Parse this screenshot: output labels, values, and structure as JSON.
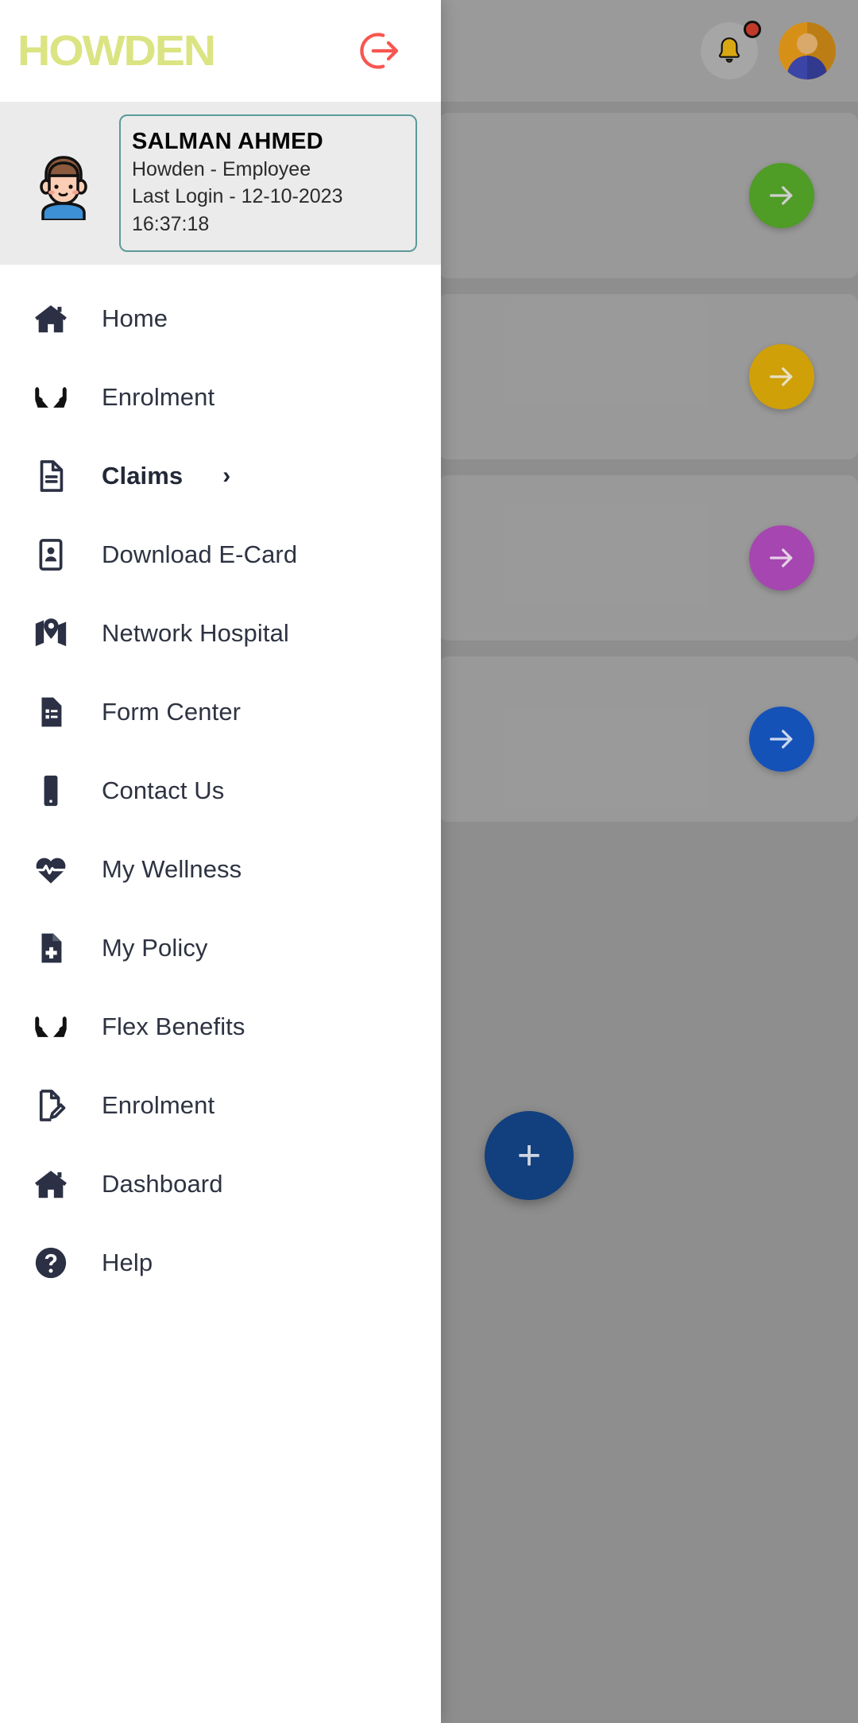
{
  "background": {
    "notification_bell": "bell-icon",
    "notification_badge": "",
    "profile_avatar": "avatar",
    "cards": [
      {
        "arrow": "arrow-right-icon",
        "color": "#4f9c26"
      },
      {
        "arrow": "arrow-right-icon",
        "color": "#cfa008"
      },
      {
        "arrow": "arrow-right-icon",
        "color": "#a646b0"
      },
      {
        "arrow": "arrow-right-icon",
        "color": "#1552b8"
      }
    ],
    "fab_label": "+"
  },
  "drawer": {
    "logo": "HOWDEN",
    "logo_color": "#dbe482",
    "logout_icon": "logout-icon",
    "logout_color": "#f8564f",
    "profile": {
      "avatar": "user-avatar-illustration",
      "name": "SALMAN AHMED",
      "role": "Howden - Employee",
      "last_login": "Last Login - 12-10-2023 16:37:18",
      "border_color": "#5c9a9a"
    },
    "menu": [
      {
        "label": "Home",
        "icon": "home-icon",
        "active": false,
        "chevron": ""
      },
      {
        "label": "Enrolment",
        "icon": "hands-icon",
        "active": false,
        "chevron": ""
      },
      {
        "label": "Claims",
        "icon": "document-icon",
        "active": true,
        "chevron": "›"
      },
      {
        "label": "Download E-Card",
        "icon": "id-card-icon",
        "active": false,
        "chevron": ""
      },
      {
        "label": "Network Hospital",
        "icon": "map-pin-icon",
        "active": false,
        "chevron": ""
      },
      {
        "label": "Form Center",
        "icon": "form-icon",
        "active": false,
        "chevron": ""
      },
      {
        "label": "Contact Us",
        "icon": "mobile-phone-icon",
        "active": false,
        "chevron": ""
      },
      {
        "label": "My Wellness",
        "icon": "heart-pulse-icon",
        "active": false,
        "chevron": ""
      },
      {
        "label": "My Policy",
        "icon": "policy-document-icon",
        "active": false,
        "chevron": ""
      },
      {
        "label": "Flex Benefits",
        "icon": "hands-icon",
        "active": false,
        "chevron": ""
      },
      {
        "label": "Enrolment",
        "icon": "edit-document-icon",
        "active": false,
        "chevron": ""
      },
      {
        "label": "Dashboard",
        "icon": "home-icon",
        "active": false,
        "chevron": ""
      },
      {
        "label": "Help",
        "icon": "help-icon",
        "active": false,
        "chevron": ""
      }
    ]
  }
}
